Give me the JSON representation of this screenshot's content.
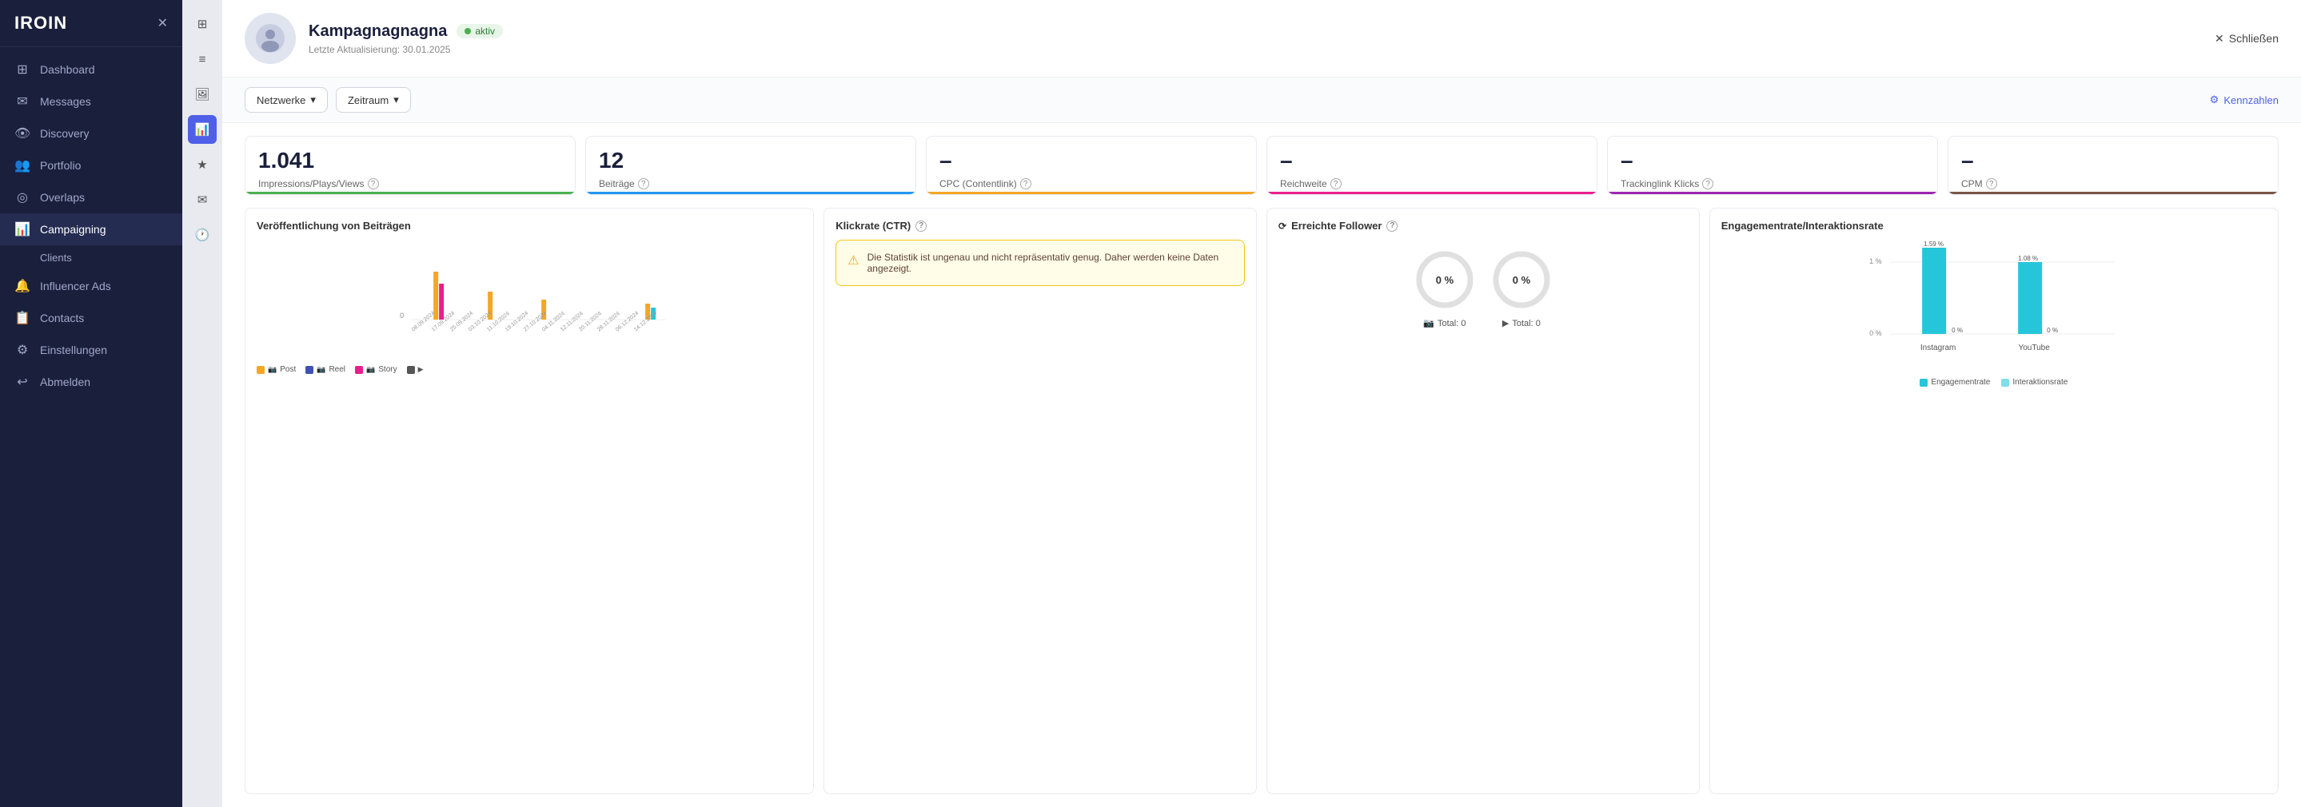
{
  "app": {
    "logo": "IROIN",
    "close_label": "×"
  },
  "sidebar": {
    "items": [
      {
        "id": "dashboard",
        "label": "Dashboard",
        "icon": "⊞",
        "active": false
      },
      {
        "id": "messages",
        "label": "Messages",
        "icon": "✉",
        "active": false
      },
      {
        "id": "discovery",
        "label": "Discovery",
        "icon": "👁",
        "active": false
      },
      {
        "id": "portfolio",
        "label": "Portfolio",
        "icon": "👥",
        "active": false
      },
      {
        "id": "overlaps",
        "label": "Overlaps",
        "icon": "◎",
        "active": false
      },
      {
        "id": "campaigning",
        "label": "Campaigning",
        "icon": "📊",
        "active": true
      },
      {
        "id": "clients",
        "label": "Clients",
        "icon": "",
        "active": false,
        "sub": true
      },
      {
        "id": "influencer-ads",
        "label": "Influencer Ads",
        "icon": "🔔",
        "active": false
      },
      {
        "id": "contacts",
        "label": "Contacts",
        "icon": "📋",
        "active": false
      },
      {
        "id": "einstellungen",
        "label": "Einstellungen",
        "icon": "⚙",
        "active": false
      },
      {
        "id": "abmelden",
        "label": "Abmelden",
        "icon": "↩",
        "active": false
      }
    ]
  },
  "icon_strip": {
    "icons": [
      {
        "id": "grid",
        "symbol": "⊞",
        "active": false
      },
      {
        "id": "list",
        "symbol": "≡",
        "active": false
      },
      {
        "id": "image",
        "symbol": "🖼",
        "active": false
      },
      {
        "id": "chart",
        "symbol": "📊",
        "active": true
      },
      {
        "id": "star",
        "symbol": "★",
        "active": false
      },
      {
        "id": "mail",
        "symbol": "✉",
        "active": false
      },
      {
        "id": "history",
        "symbol": "🕐",
        "active": false
      }
    ]
  },
  "campaign": {
    "title": "Kampagnagnagna",
    "status": "aktiv",
    "updated_label": "Letzte Aktualisierung: 30.01.2025",
    "close_label": "Schließen"
  },
  "toolbar": {
    "netzwerke_label": "Netzwerke",
    "zeitraum_label": "Zeitraum",
    "kennzahlen_label": "Kennzahlen"
  },
  "metrics": [
    {
      "id": "impressions",
      "value": "1.041",
      "label": "Impressions/Plays/Views",
      "bar_class": "bar-green"
    },
    {
      "id": "beitraege",
      "value": "12",
      "label": "Beiträge",
      "bar_class": "bar-blue"
    },
    {
      "id": "cpc",
      "value": "–",
      "label": "CPC (Contentlink)",
      "bar_class": "bar-gold"
    },
    {
      "id": "reichweite",
      "value": "–",
      "label": "Reichweite",
      "bar_class": "bar-pink"
    },
    {
      "id": "trackinglink",
      "value": "–",
      "label": "Trackinglink Klicks",
      "bar_class": "bar-purple"
    },
    {
      "id": "cpm",
      "value": "–",
      "label": "CPM",
      "bar_class": "bar-brown"
    }
  ],
  "pub_chart": {
    "title": "Veröffentlichung von Beiträgen",
    "zero_label": "0",
    "dates": [
      "08.09.2024",
      "17.09.2024",
      "25.09.2024",
      "03.10.2024",
      "11.10.2024",
      "19.10.2024",
      "27.10.2024",
      "04.11.2024",
      "12.11.2024",
      "20.11.2024",
      "28.11.2024",
      "06.12.2024",
      "14.12.2024"
    ],
    "legend": [
      {
        "label": "Post",
        "color": "#f5a623",
        "icon": "📷"
      },
      {
        "label": "Reel",
        "color": "#4051b5",
        "icon": "📷"
      },
      {
        "label": "Story",
        "color": "#e91e8c",
        "icon": "📷"
      },
      {
        "label": "YouTube",
        "color": "#333",
        "icon": "▶"
      }
    ],
    "bars": [
      {
        "date": "08.09",
        "yellow": 0,
        "blue": 0,
        "pink": 0,
        "teal": 0
      },
      {
        "date": "17.09",
        "yellow": 60,
        "blue": 0,
        "pink": 45,
        "teal": 0
      },
      {
        "date": "25.09",
        "yellow": 0,
        "blue": 0,
        "pink": 0,
        "teal": 0
      },
      {
        "date": "03.10",
        "yellow": 0,
        "blue": 0,
        "pink": 0,
        "teal": 0
      },
      {
        "date": "11.10",
        "yellow": 35,
        "blue": 0,
        "pink": 0,
        "teal": 0
      },
      {
        "date": "19.10",
        "yellow": 0,
        "blue": 0,
        "pink": 0,
        "teal": 0
      },
      {
        "date": "27.10",
        "yellow": 0,
        "blue": 0,
        "pink": 0,
        "teal": 0
      },
      {
        "date": "04.11",
        "yellow": 25,
        "blue": 0,
        "pink": 0,
        "teal": 0
      },
      {
        "date": "12.11",
        "yellow": 0,
        "blue": 0,
        "pink": 0,
        "teal": 0
      },
      {
        "date": "20.11",
        "yellow": 0,
        "blue": 0,
        "pink": 0,
        "teal": 0
      },
      {
        "date": "28.11",
        "yellow": 0,
        "blue": 0,
        "pink": 0,
        "teal": 0
      },
      {
        "date": "06.12",
        "yellow": 0,
        "blue": 0,
        "pink": 0,
        "teal": 0
      },
      {
        "date": "14.12",
        "yellow": 20,
        "blue": 0,
        "pink": 0,
        "teal": 0
      }
    ]
  },
  "ctr_panel": {
    "title": "Klickrate (CTR)",
    "warning_text": "Die Statistik ist ungenau und nicht repräsentativ genug. Daher werden keine Daten angezeigt."
  },
  "follower_panel": {
    "title": "Erreichte Follower",
    "instagram_pct": "0 %",
    "youtube_pct": "0 %",
    "instagram_total": "Total: 0",
    "youtube_total": "Total: 0"
  },
  "engagement_panel": {
    "title": "Engagementrate/Interaktionsrate",
    "instagram_label": "Instagram",
    "youtube_label": "YouTube",
    "instagram_engagement": "1.59 %",
    "instagram_interaction": "0 %",
    "youtube_engagement": "1.08 %",
    "youtube_interaction": "0 %",
    "y_labels": [
      "1 %",
      "0 %"
    ],
    "legend": [
      {
        "label": "Engagementrate",
        "color": "#26c6da"
      },
      {
        "label": "Interaktionsrate",
        "color": "#80deea"
      }
    ]
  }
}
